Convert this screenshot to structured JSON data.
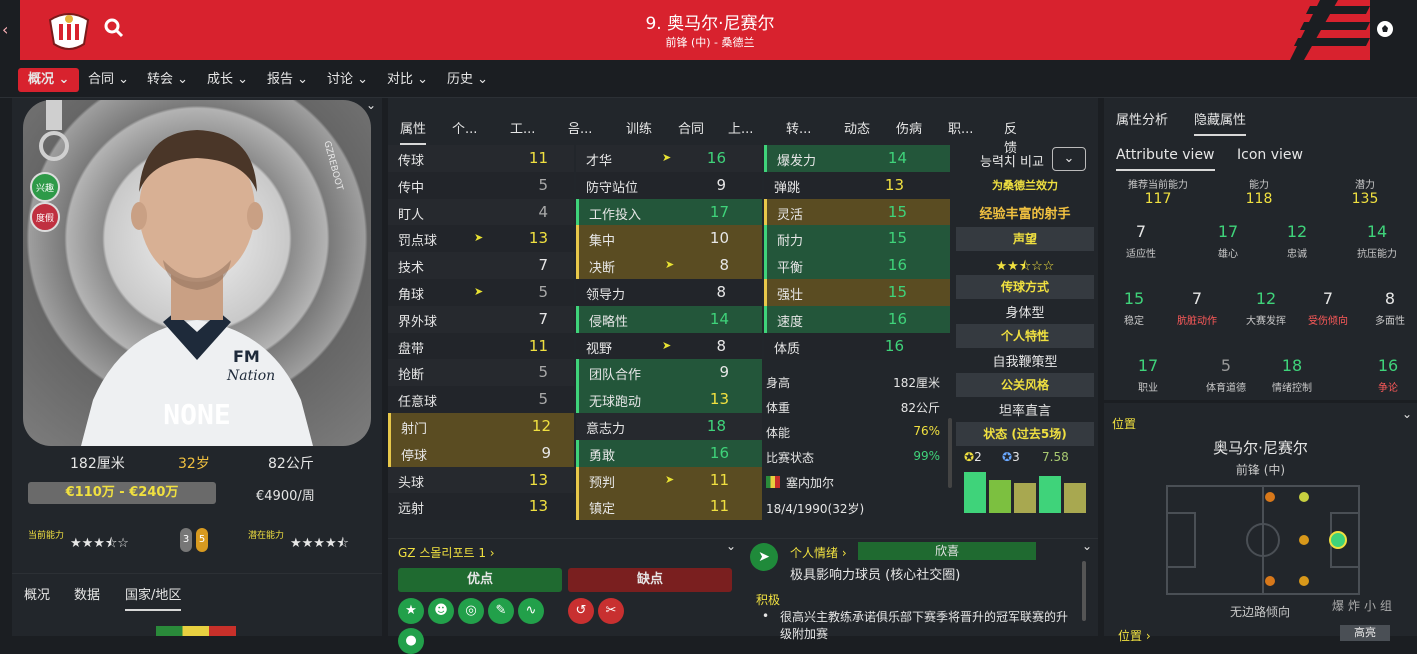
{
  "header": {
    "title": "9. 奥马尔·尼赛尔",
    "subtitle": "前锋 (中) - 桑德兰"
  },
  "nav": [
    "概况",
    "合同",
    "转会",
    "成长",
    "报告",
    "讨论",
    "对比",
    "历史"
  ],
  "profile": {
    "name_plate": "NONE",
    "watermark": "GZREBOOT",
    "badge_interest": "兴趣",
    "badge_holiday": "度假",
    "height": "182厘米",
    "age": "32岁",
    "weight": "82公斤",
    "value": "€110万 - €240万",
    "wage": "€4900/周",
    "current_ability_label": "当前能力",
    "potential_ability_label": "潜在能力",
    "ca_stars": 3.5,
    "pa_stars": 4.5,
    "badge_a": "3",
    "badge_b": "5"
  },
  "bottom_tabs": [
    "概况",
    "数据",
    "国家/地区"
  ],
  "attr_tabs": [
    "属性",
    "个...",
    "工...",
    "음...",
    "训练",
    "合同",
    "上...",
    "转...",
    "动态",
    "伤病",
    "职...",
    "反馈"
  ],
  "technical": [
    {
      "name": "传球",
      "value": "11"
    },
    {
      "name": "传中",
      "value": "5"
    },
    {
      "name": "盯人",
      "value": "4"
    },
    {
      "name": "罚点球",
      "value": "13"
    },
    {
      "name": "技术",
      "value": "7"
    },
    {
      "name": "角球",
      "value": "5"
    },
    {
      "name": "界外球",
      "value": "7"
    },
    {
      "name": "盘带",
      "value": "11"
    },
    {
      "name": "抢断",
      "value": "5"
    },
    {
      "name": "任意球",
      "value": "5"
    },
    {
      "name": "射门",
      "value": "12"
    },
    {
      "name": "停球",
      "value": "9"
    },
    {
      "name": "头球",
      "value": "13"
    },
    {
      "name": "远射",
      "value": "13"
    }
  ],
  "mental": [
    {
      "name": "才华",
      "value": "16"
    },
    {
      "name": "防守站位",
      "value": "9"
    },
    {
      "name": "工作投入",
      "value": "17"
    },
    {
      "name": "集中",
      "value": "10"
    },
    {
      "name": "决断",
      "value": "8"
    },
    {
      "name": "领导力",
      "value": "8"
    },
    {
      "name": "侵略性",
      "value": "14"
    },
    {
      "name": "视野",
      "value": "8"
    },
    {
      "name": "团队合作",
      "value": "9"
    },
    {
      "name": "无球跑动",
      "value": "13"
    },
    {
      "name": "意志力",
      "value": "18"
    },
    {
      "name": "勇敢",
      "value": "16"
    },
    {
      "name": "预判",
      "value": "11"
    },
    {
      "name": "镇定",
      "value": "11"
    }
  ],
  "physical": [
    {
      "name": "爆发力",
      "value": "14"
    },
    {
      "name": "弹跳",
      "value": "13"
    },
    {
      "name": "灵活",
      "value": "15"
    },
    {
      "name": "耐力",
      "value": "15"
    },
    {
      "name": "平衡",
      "value": "16"
    },
    {
      "name": "强壮",
      "value": "15"
    },
    {
      "name": "速度",
      "value": "16"
    },
    {
      "name": "体质",
      "value": "16"
    }
  ],
  "info": [
    {
      "label": "身高",
      "value": "182厘米"
    },
    {
      "label": "体重",
      "value": "82公斤"
    },
    {
      "label": "体能",
      "value": "76%"
    },
    {
      "label": "比赛状态",
      "value": "99%"
    }
  ],
  "nation": "塞内加尔",
  "birth": "18/4/1990(32岁)",
  "side": {
    "compare": "능력치 비교",
    "plays_for": "为桑德兰效力",
    "role": "经验丰富的射手",
    "reputation_label": "声望",
    "reputation_stars": 2.5,
    "style_label": "传球方式",
    "style_value": "身体型",
    "trait_label": "个人特性",
    "trait_value": "自我鞭策型",
    "media_label": "公关风格",
    "media_value": "坦率直言",
    "form_label": "状态 (过去5场)",
    "goals": "2",
    "assists": "3",
    "rating": "7.58",
    "form": [
      8,
      6.5,
      5.8,
      7.2,
      5.8
    ]
  },
  "strengths": {
    "header": "GZ 스몰리포트 1",
    "pros_label": "优点",
    "cons_label": "缺点"
  },
  "mood": {
    "label": "个人情绪",
    "status": "欣喜",
    "desc": "极具影响力球员 (核心社交圈)",
    "positive_label": "积极",
    "bullet": "很高兴主教练承诺俱乐部下赛季将晋升的冠军联赛的升级附加赛"
  },
  "analysis": {
    "tabs": [
      "属性分析",
      "隐藏属性"
    ],
    "subtabs": [
      "Attribute view",
      "Icon view"
    ],
    "top": [
      {
        "label": "推荐当前能力",
        "value": "117"
      },
      {
        "label": "能力",
        "value": "118"
      },
      {
        "label": "潜力",
        "value": "135"
      }
    ],
    "grid": [
      {
        "value": "7",
        "label": "适应性",
        "vc": "w",
        "lc": "sm"
      },
      {
        "value": "17",
        "label": "雄心",
        "vc": "g",
        "lc": "sm"
      },
      {
        "value": "12",
        "label": "忠诚",
        "vc": "g",
        "lc": "sm"
      },
      {
        "value": "14",
        "label": "抗压能力",
        "vc": "g",
        "lc": "sm"
      },
      {
        "value": "15",
        "label": "稳定",
        "vc": "g",
        "lc": "sm"
      },
      {
        "value": "7",
        "label": "肮脏动作",
        "vc": "w",
        "lc": "r"
      },
      {
        "value": "12",
        "label": "大赛发挥",
        "vc": "g",
        "lc": "sm"
      },
      {
        "value": "7",
        "label": "受伤倾向",
        "vc": "w",
        "lc": "r"
      },
      {
        "value": "8",
        "label": "多面性",
        "vc": "w",
        "lc": "sm"
      },
      {
        "value": "17",
        "label": "职业",
        "vc": "g",
        "lc": "sm"
      },
      {
        "value": "5",
        "label": "体育道德",
        "vc": "gr",
        "lc": "sm"
      },
      {
        "value": "18",
        "label": "情绪控制",
        "vc": "g",
        "lc": "sm"
      },
      {
        "value": "16",
        "label": "争论",
        "vc": "g",
        "lc": "r"
      }
    ]
  },
  "position": {
    "label": "位置",
    "name": "奥马尔·尼赛尔",
    "role": "前锋 (中)",
    "footnote": "无边路倾向",
    "bottom_label": "位置",
    "bottom_right": "高亮"
  },
  "watermark_text": "爆炸小组"
}
